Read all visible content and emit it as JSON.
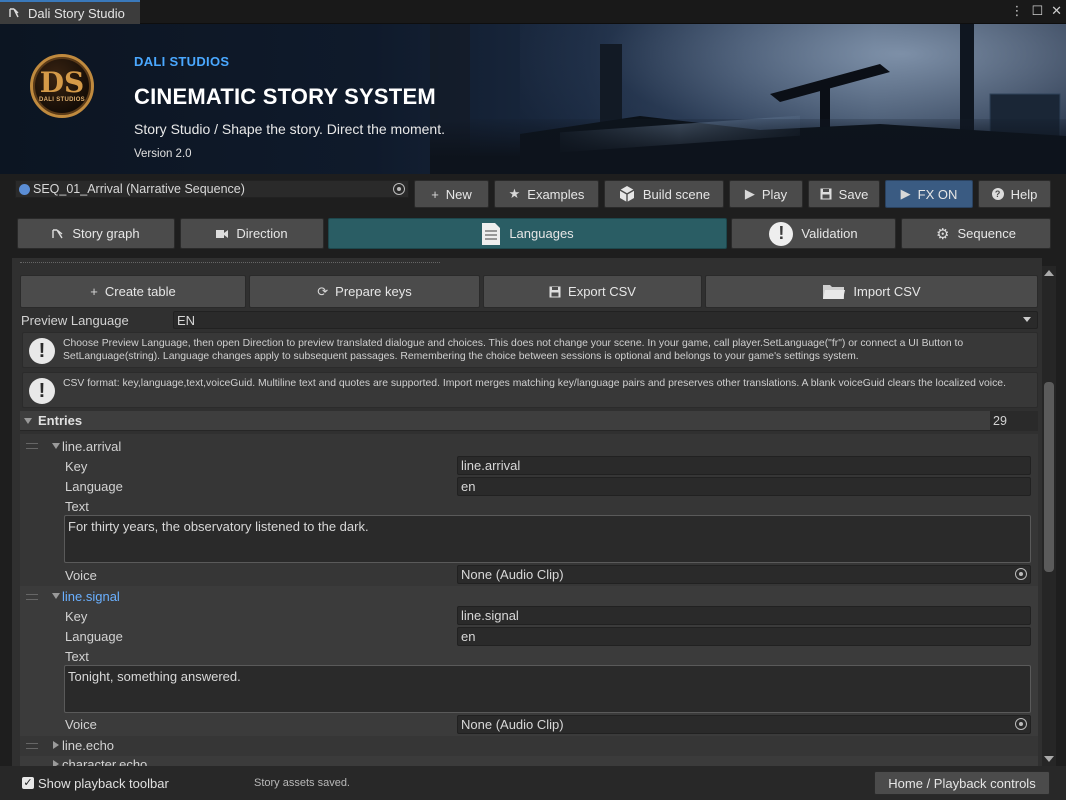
{
  "window": {
    "tab_title": "Dali Story Studio",
    "controls": {
      "menu": "⋮",
      "maximize": "☐",
      "close": "✕"
    }
  },
  "header": {
    "logo_monogram": "DS",
    "logo_text": "DALI STUDIOS",
    "brand": "DALI STUDIOS",
    "headline": "CINEMATIC STORY SYSTEM",
    "tagline": "Story Studio / Shape the story. Direct the moment.",
    "version": "Version 2.0"
  },
  "toolbar": {
    "sequence_field": "SEQ_01_Arrival (Narrative Sequence)",
    "buttons": {
      "new": "New",
      "examples": "Examples",
      "build_scene": "Build scene",
      "play": "Play",
      "save": "Save",
      "fx": "FX ON",
      "help": "Help"
    }
  },
  "tabs": {
    "story_graph": "Story graph",
    "direction": "Direction",
    "languages": "Languages",
    "validation": "Validation",
    "sequence": "Sequence",
    "active": "Languages"
  },
  "languages": {
    "actions": {
      "create_table": "Create table",
      "prepare_keys": "Prepare keys",
      "export_csv": "Export CSV",
      "import_csv": "Import CSV"
    },
    "preview_language_label": "Preview Language",
    "preview_language_value": "EN",
    "help_preview": "Choose Preview Language, then open Direction to preview translated dialogue and choices. This does not change your scene. In your game, call player.SetLanguage(\"fr\") or connect a UI Button to SetLanguage(string). Language changes apply to subsequent passages. Remembering the choice between sessions is optional and belongs to your game's settings system.",
    "help_csv": "CSV format: key,language,text,voiceGuid. Multiline text and quotes are supported. Import merges matching key/language pairs and preserves other translations. A blank voiceGuid clears the localized voice.",
    "entries_label": "Entries",
    "entries_count": "29",
    "field_labels": {
      "key": "Key",
      "language": "Language",
      "text": "Text",
      "voice": "Voice"
    },
    "entries": [
      {
        "name": "line.arrival",
        "key": "line.arrival",
        "language": "en",
        "text": "For thirty years, the observatory listened to the dark.",
        "voice": "None (Audio Clip)"
      },
      {
        "name": "line.signal",
        "key": "line.signal",
        "language": "en",
        "text": "Tonight, something answered.",
        "voice": "None (Audio Clip)"
      },
      {
        "name": "line.echo"
      },
      {
        "name": "character.echo"
      }
    ]
  },
  "footer": {
    "show_playback_toolbar": "Show playback toolbar",
    "show_playback_checked": true,
    "status": "Story assets saved.",
    "home_button": "Home / Playback controls"
  }
}
